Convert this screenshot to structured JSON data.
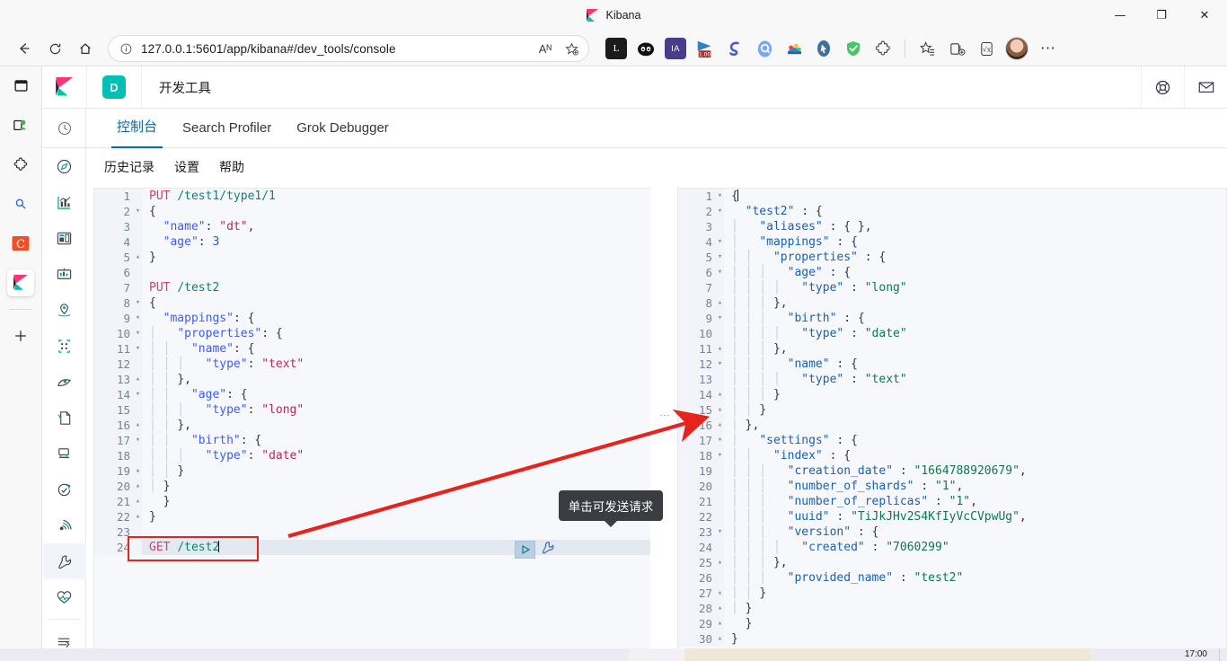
{
  "window": {
    "title": "Kibana",
    "minimize_label": "—",
    "maximize_label": "❐",
    "close_label": "✕"
  },
  "browser": {
    "back_label": "←",
    "reload_label": "⟳",
    "home_label": "⌂",
    "url": "127.0.0.1:5601/app/kibana#/dev_tools/console",
    "info_icon": "info-circle-icon",
    "read_aloud_label": "Aᴺ",
    "favorite_label": "☆",
    "more_label": "⋯",
    "extensions": [
      {
        "name": "lastpass-extension",
        "label": "L",
        "color": "#1b1b1b"
      },
      {
        "name": "panda-extension",
        "label": "●●",
        "color": "#141414"
      },
      {
        "name": "ia-extension",
        "label": "IA",
        "color": "#4a3c8c"
      },
      {
        "name": "video-speed-extension",
        "label": "1.00",
        "color": "#2f7fd1"
      },
      {
        "name": "grammar-extension",
        "label": "S",
        "color": "#4a5bd6"
      },
      {
        "name": "search-extension",
        "label": "Q",
        "color": "#7aa7f0"
      },
      {
        "name": "colorpick-extension",
        "label": "⚘",
        "color": "#f2c14e"
      },
      {
        "name": "pointer-extension",
        "label": "➤",
        "color": "#3f6fa0"
      },
      {
        "name": "shield-extension",
        "label": "✓",
        "color": "#49c46a"
      },
      {
        "name": "puzzle-extensions-icon",
        "label": "⌘",
        "color": "#ffffff"
      }
    ],
    "collections_label": "☆",
    "split_screen_label": "⧉",
    "math_solver_label": "√x",
    "profile_name": "avatar"
  },
  "browser_sidebar": {
    "items": [
      {
        "name": "sidebar-toggle-icon",
        "label": "▤"
      },
      {
        "name": "collections-icon",
        "label": "♡"
      },
      {
        "name": "extensions-icon",
        "label": "⌘"
      },
      {
        "name": "search-icon",
        "label": "⚲"
      },
      {
        "name": "copilot-icon",
        "label": "C"
      },
      {
        "name": "kibana-tab-icon",
        "label": "K"
      },
      {
        "name": "add-tab-icon",
        "label": "+"
      }
    ]
  },
  "kibana_header": {
    "logo": "kibana-logo",
    "space_badge": "D",
    "breadcrumb": "开发工具",
    "help_icon": "help-lifering-icon",
    "newsfeed_icon": "newsfeed-mail-icon"
  },
  "kibana_nav": {
    "recent_icon": "recently-viewed-clock-icon",
    "items": [
      {
        "name": "nav-item-discover",
        "icon": "compass-icon"
      },
      {
        "name": "nav-item-visualize",
        "icon": "bar-chart-icon"
      },
      {
        "name": "nav-item-dashboard",
        "icon": "dashboard-icon"
      },
      {
        "name": "nav-item-canvas",
        "icon": "canvas-icon"
      },
      {
        "name": "nav-item-maps",
        "icon": "map-pin-icon"
      },
      {
        "name": "nav-item-machine-learning",
        "icon": "machine-learning-icon"
      },
      {
        "name": "nav-item-graph",
        "icon": "graph-icon"
      },
      {
        "name": "nav-item-visual-builder",
        "icon": "page-icon"
      },
      {
        "name": "nav-item-logs",
        "icon": "logs-icon"
      },
      {
        "name": "nav-item-uptime",
        "icon": "uptime-icon"
      },
      {
        "name": "nav-item-apm",
        "icon": "apm-signal-icon"
      },
      {
        "name": "nav-item-dev-tools",
        "icon": "wrench-icon",
        "selected": true
      },
      {
        "name": "nav-item-monitoring",
        "icon": "heartbeat-icon"
      }
    ],
    "collapse_icon": "collapse-arrow-icon"
  },
  "dev_tools": {
    "tabs": [
      {
        "label": "控制台",
        "active": true
      },
      {
        "label": "Search Profiler",
        "active": false
      },
      {
        "label": "Grok Debugger",
        "active": false
      }
    ],
    "actions": [
      {
        "label": "历史记录"
      },
      {
        "label": "设置"
      },
      {
        "label": "帮助"
      }
    ],
    "tooltip": "单击可发送请求",
    "play_icon": "play-send-request-icon",
    "wrench_icon": "wrench-options-icon",
    "splitter_icon": "panel-resize-grip-icon"
  },
  "request_editor": {
    "current_line": 24,
    "lines": [
      {
        "n": 1,
        "fold": "",
        "indent": 0,
        "tokens": [
          {
            "c": "m",
            "t": "PUT"
          },
          {
            "c": "p",
            "t": " "
          },
          {
            "c": "u",
            "t": "/test1/type1/1"
          }
        ]
      },
      {
        "n": 2,
        "fold": "▾",
        "indent": 0,
        "tokens": [
          {
            "c": "p",
            "t": "{"
          }
        ]
      },
      {
        "n": 3,
        "fold": "",
        "indent": 0,
        "tokens": [
          {
            "c": "p",
            "t": "  "
          },
          {
            "c": "k",
            "t": "\"name\""
          },
          {
            "c": "p",
            "t": ": "
          },
          {
            "c": "s",
            "t": "\"dt\""
          },
          {
            "c": "p",
            "t": ","
          }
        ]
      },
      {
        "n": 4,
        "fold": "",
        "indent": 0,
        "tokens": [
          {
            "c": "p",
            "t": "  "
          },
          {
            "c": "k",
            "t": "\"age\""
          },
          {
            "c": "p",
            "t": ": "
          },
          {
            "c": "n",
            "t": "3"
          }
        ]
      },
      {
        "n": 5,
        "fold": "▴",
        "indent": 0,
        "tokens": [
          {
            "c": "p",
            "t": "}"
          }
        ]
      },
      {
        "n": 6,
        "fold": "",
        "indent": 0,
        "tokens": []
      },
      {
        "n": 7,
        "fold": "",
        "indent": 0,
        "tokens": [
          {
            "c": "m",
            "t": "PUT"
          },
          {
            "c": "p",
            "t": " "
          },
          {
            "c": "u",
            "t": "/test2"
          }
        ]
      },
      {
        "n": 8,
        "fold": "▾",
        "indent": 0,
        "tokens": [
          {
            "c": "p",
            "t": "{"
          }
        ]
      },
      {
        "n": 9,
        "fold": "▾",
        "indent": 0,
        "tokens": [
          {
            "c": "p",
            "t": "  "
          },
          {
            "c": "k",
            "t": "\"mappings\""
          },
          {
            "c": "p",
            "t": ": {"
          }
        ]
      },
      {
        "n": 10,
        "fold": "▾",
        "indent": 1,
        "tokens": [
          {
            "c": "p",
            "t": "  "
          },
          {
            "c": "k",
            "t": "\"properties\""
          },
          {
            "c": "p",
            "t": ": {"
          }
        ]
      },
      {
        "n": 11,
        "fold": "▾",
        "indent": 2,
        "tokens": [
          {
            "c": "p",
            "t": "  "
          },
          {
            "c": "k",
            "t": "\"name\""
          },
          {
            "c": "p",
            "t": ": {"
          }
        ]
      },
      {
        "n": 12,
        "fold": "",
        "indent": 3,
        "tokens": [
          {
            "c": "p",
            "t": "  "
          },
          {
            "c": "k",
            "t": "\"type\""
          },
          {
            "c": "p",
            "t": ": "
          },
          {
            "c": "s",
            "t": "\"text\""
          }
        ]
      },
      {
        "n": 13,
        "fold": "▴",
        "indent": 2,
        "tokens": [
          {
            "c": "p",
            "t": "},"
          }
        ]
      },
      {
        "n": 14,
        "fold": "▾",
        "indent": 2,
        "tokens": [
          {
            "c": "p",
            "t": "  "
          },
          {
            "c": "k",
            "t": "\"age\""
          },
          {
            "c": "p",
            "t": ": {"
          }
        ]
      },
      {
        "n": 15,
        "fold": "",
        "indent": 3,
        "tokens": [
          {
            "c": "p",
            "t": "  "
          },
          {
            "c": "k",
            "t": "\"type\""
          },
          {
            "c": "p",
            "t": ": "
          },
          {
            "c": "s",
            "t": "\"long\""
          }
        ]
      },
      {
        "n": 16,
        "fold": "▴",
        "indent": 2,
        "tokens": [
          {
            "c": "p",
            "t": "},"
          }
        ]
      },
      {
        "n": 17,
        "fold": "▾",
        "indent": 2,
        "tokens": [
          {
            "c": "p",
            "t": "  "
          },
          {
            "c": "k",
            "t": "\"birth\""
          },
          {
            "c": "p",
            "t": ": {"
          }
        ]
      },
      {
        "n": 18,
        "fold": "",
        "indent": 3,
        "tokens": [
          {
            "c": "p",
            "t": "  "
          },
          {
            "c": "k",
            "t": "\"type\""
          },
          {
            "c": "p",
            "t": ": "
          },
          {
            "c": "s",
            "t": "\"date\""
          }
        ]
      },
      {
        "n": 19,
        "fold": "▴",
        "indent": 2,
        "tokens": [
          {
            "c": "p",
            "t": "}"
          }
        ]
      },
      {
        "n": 20,
        "fold": "▴",
        "indent": 1,
        "tokens": [
          {
            "c": "p",
            "t": "}"
          }
        ]
      },
      {
        "n": 21,
        "fold": "▴",
        "indent": 0,
        "tokens": [
          {
            "c": "p",
            "t": "  }"
          }
        ]
      },
      {
        "n": 22,
        "fold": "▴",
        "indent": 0,
        "tokens": [
          {
            "c": "p",
            "t": "}"
          }
        ]
      },
      {
        "n": 23,
        "fold": "",
        "indent": 0,
        "tokens": []
      },
      {
        "n": 24,
        "fold": "",
        "indent": 0,
        "tokens": [
          {
            "c": "m",
            "t": "GET"
          },
          {
            "c": "p",
            "t": " "
          },
          {
            "c": "u",
            "t": "/test2"
          }
        ],
        "caret": true
      }
    ]
  },
  "response_editor": {
    "lines": [
      {
        "n": 1,
        "fold": "▾",
        "indent": 0,
        "tokens": [
          {
            "c": "p",
            "t": "{"
          }
        ],
        "cursor": true
      },
      {
        "n": 2,
        "fold": "▾",
        "indent": 0,
        "tokens": [
          {
            "c": "p",
            "t": "  "
          },
          {
            "c": "ky",
            "t": "\"test2\""
          },
          {
            "c": "p",
            "t": " : {"
          }
        ]
      },
      {
        "n": 3,
        "fold": "",
        "indent": 1,
        "tokens": [
          {
            "c": "p",
            "t": "  "
          },
          {
            "c": "ky",
            "t": "\"aliases\""
          },
          {
            "c": "p",
            "t": " : { },"
          }
        ]
      },
      {
        "n": 4,
        "fold": "▾",
        "indent": 1,
        "tokens": [
          {
            "c": "p",
            "t": "  "
          },
          {
            "c": "ky",
            "t": "\"mappings\""
          },
          {
            "c": "p",
            "t": " : {"
          }
        ]
      },
      {
        "n": 5,
        "fold": "▾",
        "indent": 2,
        "tokens": [
          {
            "c": "p",
            "t": "  "
          },
          {
            "c": "ky",
            "t": "\"properties\""
          },
          {
            "c": "p",
            "t": " : {"
          }
        ]
      },
      {
        "n": 6,
        "fold": "▾",
        "indent": 3,
        "tokens": [
          {
            "c": "p",
            "t": "  "
          },
          {
            "c": "ky",
            "t": "\"age\""
          },
          {
            "c": "p",
            "t": " : {"
          }
        ]
      },
      {
        "n": 7,
        "fold": "",
        "indent": 4,
        "tokens": [
          {
            "c": "p",
            "t": "  "
          },
          {
            "c": "ky",
            "t": "\"type\""
          },
          {
            "c": "p",
            "t": " : "
          },
          {
            "c": "sv",
            "t": "\"long\""
          }
        ]
      },
      {
        "n": 8,
        "fold": "▴",
        "indent": 3,
        "tokens": [
          {
            "c": "p",
            "t": "},"
          }
        ]
      },
      {
        "n": 9,
        "fold": "▾",
        "indent": 3,
        "tokens": [
          {
            "c": "p",
            "t": "  "
          },
          {
            "c": "ky",
            "t": "\"birth\""
          },
          {
            "c": "p",
            "t": " : {"
          }
        ]
      },
      {
        "n": 10,
        "fold": "",
        "indent": 4,
        "tokens": [
          {
            "c": "p",
            "t": "  "
          },
          {
            "c": "ky",
            "t": "\"type\""
          },
          {
            "c": "p",
            "t": " : "
          },
          {
            "c": "sv",
            "t": "\"date\""
          }
        ]
      },
      {
        "n": 11,
        "fold": "▴",
        "indent": 3,
        "tokens": [
          {
            "c": "p",
            "t": "},"
          }
        ]
      },
      {
        "n": 12,
        "fold": "▾",
        "indent": 3,
        "tokens": [
          {
            "c": "p",
            "t": "  "
          },
          {
            "c": "ky",
            "t": "\"name\""
          },
          {
            "c": "p",
            "t": " : {"
          }
        ]
      },
      {
        "n": 13,
        "fold": "",
        "indent": 4,
        "tokens": [
          {
            "c": "p",
            "t": "  "
          },
          {
            "c": "ky",
            "t": "\"type\""
          },
          {
            "c": "p",
            "t": " : "
          },
          {
            "c": "sv",
            "t": "\"text\""
          }
        ]
      },
      {
        "n": 14,
        "fold": "▴",
        "indent": 3,
        "tokens": [
          {
            "c": "p",
            "t": "}"
          }
        ]
      },
      {
        "n": 15,
        "fold": "▴",
        "indent": 2,
        "tokens": [
          {
            "c": "p",
            "t": "}"
          }
        ]
      },
      {
        "n": 16,
        "fold": "▴",
        "indent": 1,
        "tokens": [
          {
            "c": "p",
            "t": "},"
          }
        ]
      },
      {
        "n": 17,
        "fold": "▾",
        "indent": 1,
        "tokens": [
          {
            "c": "p",
            "t": "  "
          },
          {
            "c": "ky",
            "t": "\"settings\""
          },
          {
            "c": "p",
            "t": " : {"
          }
        ]
      },
      {
        "n": 18,
        "fold": "▾",
        "indent": 2,
        "tokens": [
          {
            "c": "p",
            "t": "  "
          },
          {
            "c": "ky",
            "t": "\"index\""
          },
          {
            "c": "p",
            "t": " : {"
          }
        ]
      },
      {
        "n": 19,
        "fold": "",
        "indent": 3,
        "tokens": [
          {
            "c": "p",
            "t": "  "
          },
          {
            "c": "ky",
            "t": "\"creation_date\""
          },
          {
            "c": "p",
            "t": " : "
          },
          {
            "c": "sv",
            "t": "\"1664788920679\""
          },
          {
            "c": "p",
            "t": ","
          }
        ]
      },
      {
        "n": 20,
        "fold": "",
        "indent": 3,
        "tokens": [
          {
            "c": "p",
            "t": "  "
          },
          {
            "c": "ky",
            "t": "\"number_of_shards\""
          },
          {
            "c": "p",
            "t": " : "
          },
          {
            "c": "sv",
            "t": "\"1\""
          },
          {
            "c": "p",
            "t": ","
          }
        ]
      },
      {
        "n": 21,
        "fold": "",
        "indent": 3,
        "tokens": [
          {
            "c": "p",
            "t": "  "
          },
          {
            "c": "ky",
            "t": "\"number_of_replicas\""
          },
          {
            "c": "p",
            "t": " : "
          },
          {
            "c": "sv",
            "t": "\"1\""
          },
          {
            "c": "p",
            "t": ","
          }
        ]
      },
      {
        "n": 22,
        "fold": "",
        "indent": 3,
        "tokens": [
          {
            "c": "p",
            "t": "  "
          },
          {
            "c": "ky",
            "t": "\"uuid\""
          },
          {
            "c": "p",
            "t": " : "
          },
          {
            "c": "sv",
            "t": "\"TiJkJHv2S4KfIyVcCVpwUg\""
          },
          {
            "c": "p",
            "t": ","
          }
        ]
      },
      {
        "n": 23,
        "fold": "▾",
        "indent": 3,
        "tokens": [
          {
            "c": "p",
            "t": "  "
          },
          {
            "c": "ky",
            "t": "\"version\""
          },
          {
            "c": "p",
            "t": " : {"
          }
        ]
      },
      {
        "n": 24,
        "fold": "",
        "indent": 4,
        "tokens": [
          {
            "c": "p",
            "t": "  "
          },
          {
            "c": "ky",
            "t": "\"created\""
          },
          {
            "c": "p",
            "t": " : "
          },
          {
            "c": "sv",
            "t": "\"7060299\""
          }
        ]
      },
      {
        "n": 25,
        "fold": "▴",
        "indent": 3,
        "tokens": [
          {
            "c": "p",
            "t": "},"
          }
        ]
      },
      {
        "n": 26,
        "fold": "",
        "indent": 3,
        "tokens": [
          {
            "c": "p",
            "t": "  "
          },
          {
            "c": "ky",
            "t": "\"provided_name\""
          },
          {
            "c": "p",
            "t": " : "
          },
          {
            "c": "sv",
            "t": "\"test2\""
          }
        ]
      },
      {
        "n": 27,
        "fold": "▴",
        "indent": 2,
        "tokens": [
          {
            "c": "p",
            "t": "}"
          }
        ]
      },
      {
        "n": 28,
        "fold": "▴",
        "indent": 1,
        "tokens": [
          {
            "c": "p",
            "t": "}"
          }
        ]
      },
      {
        "n": 29,
        "fold": "▴",
        "indent": 0,
        "tokens": [
          {
            "c": "p",
            "t": "  }"
          }
        ]
      },
      {
        "n": 30,
        "fold": "▴",
        "indent": 0,
        "tokens": [
          {
            "c": "p",
            "t": "}"
          }
        ]
      }
    ]
  },
  "annotations": {
    "highlight_box": "red-highlight-box-around-get-test2",
    "arrow": "red-arrow-pointing-to-response-line-15",
    "arrow_color": "#e8231e"
  },
  "taskbar": {
    "clock": "17:00"
  }
}
